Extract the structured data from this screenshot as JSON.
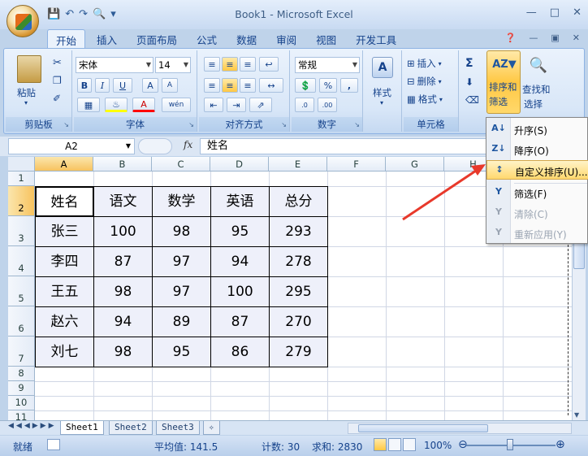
{
  "window": {
    "title": "Book1 - Microsoft Excel"
  },
  "ribbon": {
    "tabs": [
      "开始",
      "插入",
      "页面布局",
      "公式",
      "数据",
      "审阅",
      "视图",
      "开发工具"
    ],
    "active_tab": "开始",
    "clipboard": {
      "paste_label": "粘贴",
      "group_label": "剪贴板"
    },
    "font": {
      "font_name": "宋体",
      "font_size": "14",
      "bold": "B",
      "italic": "I",
      "underline": "U",
      "group_label": "字体",
      "grow": "A",
      "shrink": "A",
      "phonetic": "wén"
    },
    "alignment": {
      "group_label": "对齐方式"
    },
    "number": {
      "format": "常规",
      "percent": "%",
      "comma": ",",
      "group_label": "数字"
    },
    "styles": {
      "label": "样式"
    },
    "cells": {
      "insert": "插入",
      "delete": "删除",
      "format": "格式",
      "group_label": "单元格"
    },
    "editing": {
      "sum": "Σ",
      "sort_filter": "排序和",
      "sort_filter2": "筛选",
      "find_select": "查找和",
      "find_select2": "选择"
    }
  },
  "formula_bar": {
    "name_box": "A2",
    "fx": "fx",
    "content": "姓名"
  },
  "grid": {
    "columns": [
      "A",
      "B",
      "C",
      "D",
      "E",
      "F",
      "G",
      "H"
    ],
    "rows": [
      "1",
      "2",
      "3",
      "4",
      "5",
      "6",
      "7",
      "8",
      "9",
      "10",
      "11"
    ],
    "table": {
      "header": [
        "姓名",
        "语文",
        "数学",
        "英语",
        "总分"
      ],
      "rows": [
        [
          "张三",
          "100",
          "98",
          "95",
          "293"
        ],
        [
          "李四",
          "87",
          "97",
          "94",
          "278"
        ],
        [
          "王五",
          "98",
          "97",
          "100",
          "295"
        ],
        [
          "赵六",
          "94",
          "89",
          "87",
          "270"
        ],
        [
          "刘七",
          "98",
          "95",
          "86",
          "279"
        ]
      ]
    }
  },
  "sheets": [
    "Sheet1",
    "Sheet2",
    "Sheet3"
  ],
  "active_sheet": "Sheet1",
  "status_bar": {
    "mode": "就绪",
    "average": "平均值: 141.5",
    "count": "计数: 30",
    "sum": "求和: 2830",
    "zoom": "100%"
  },
  "sort_menu": {
    "items": [
      {
        "icon": "A↓",
        "label": "升序(S)",
        "enabled": true
      },
      {
        "icon": "Z↓",
        "label": "降序(O)",
        "enabled": true
      },
      {
        "icon": "↕",
        "label": "自定义排序(U)...",
        "enabled": true,
        "highlighted": true
      },
      {
        "icon": "Y",
        "label": "筛选(F)",
        "enabled": true
      },
      {
        "icon": "Y",
        "label": "清除(C)",
        "enabled": false
      },
      {
        "icon": "Y",
        "label": "重新应用(Y)",
        "enabled": false
      }
    ]
  },
  "colors": {
    "accent_arrow": "#e8392b",
    "selection_header": "#f7c35f"
  }
}
